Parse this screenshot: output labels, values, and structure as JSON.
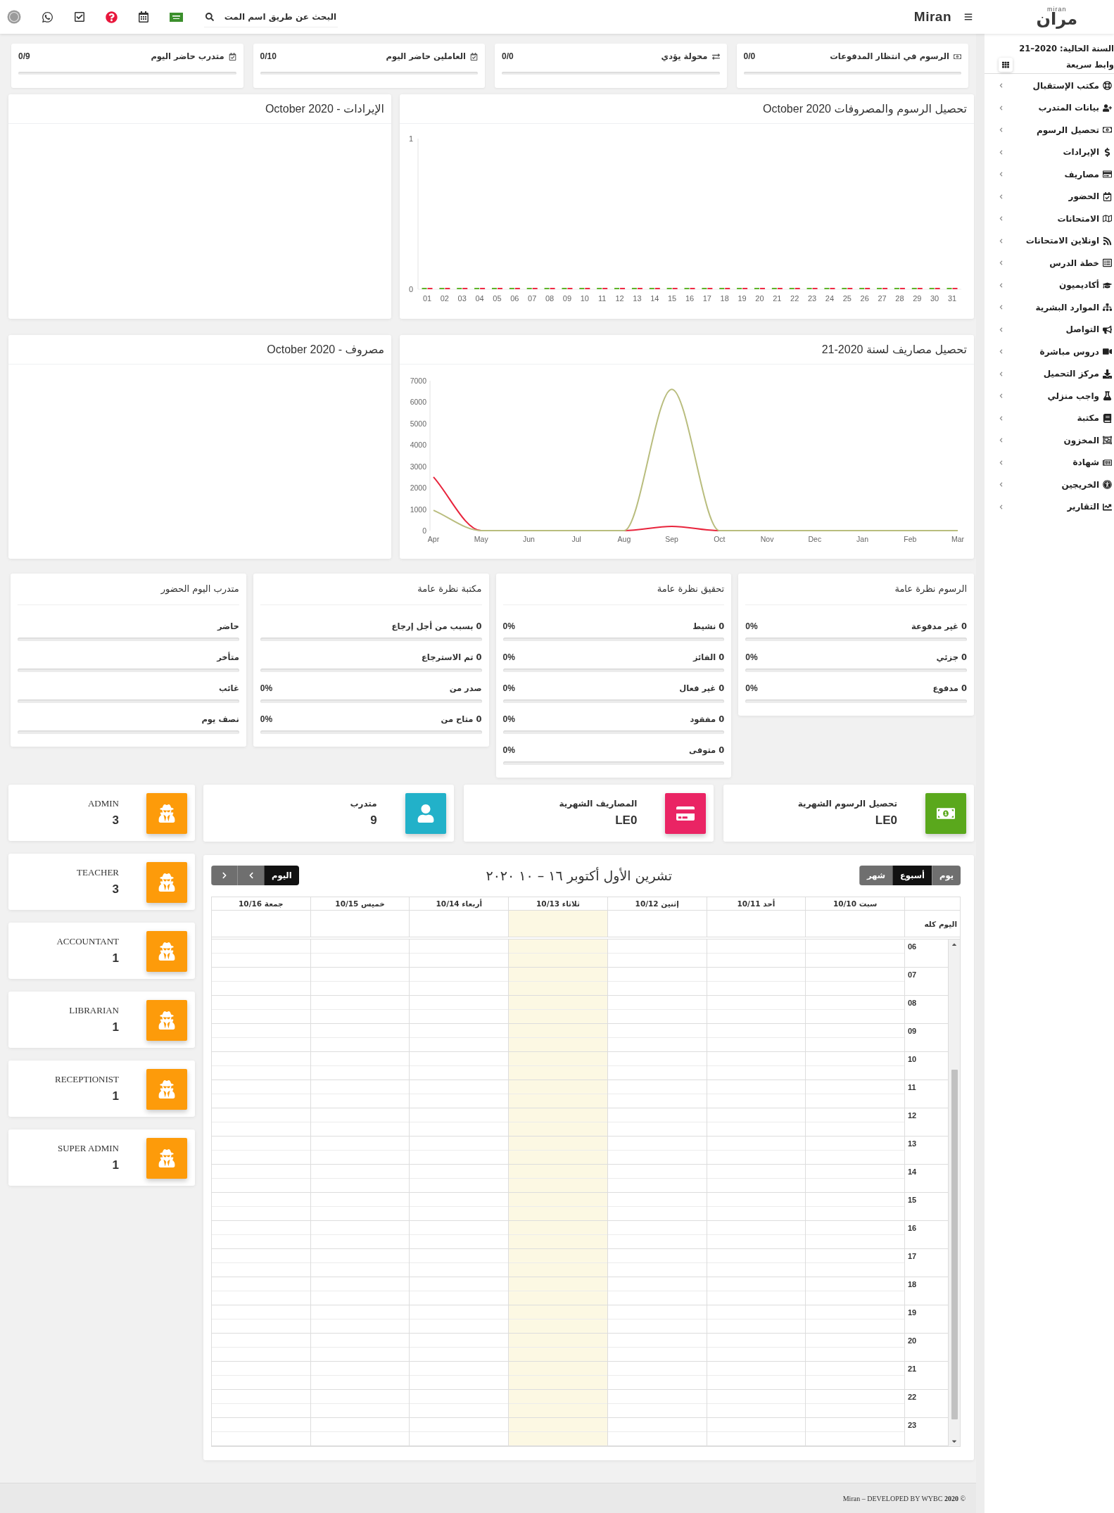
{
  "topbar": {
    "logo": {
      "text": "مران",
      "tagline": "miran"
    },
    "brand": "Miran",
    "search": {
      "placeholder": "البحث عن طريق اسم المت"
    }
  },
  "sidebar": {
    "year": "السنة الحالية: 2020–21",
    "quick_links": "وابط سريعة",
    "items": [
      {
        "label": "مكتب الإستقبال"
      },
      {
        "label": "بيانات المتدرب"
      },
      {
        "label": "تحصيل الرسوم"
      },
      {
        "label": "الإيرادات"
      },
      {
        "label": "مصاريف"
      },
      {
        "label": "الحضور"
      },
      {
        "label": "الامتحانات"
      },
      {
        "label": "اونلاين الامتحانات"
      },
      {
        "label": "خطة الدرس"
      },
      {
        "label": "أكاديميون"
      },
      {
        "label": "الموارد البشرية"
      },
      {
        "label": "التواصل"
      },
      {
        "label": "دروس مباشرة"
      },
      {
        "label": "مركز التحميل"
      },
      {
        "label": "واجب منزلي"
      },
      {
        "label": "مكتبة"
      },
      {
        "label": "المخزون"
      },
      {
        "label": "شهادة"
      },
      {
        "label": "الخريجين"
      },
      {
        "label": "التقارير"
      }
    ]
  },
  "stat_cards": [
    {
      "title": "الرسوم في انتظار المدفوعات",
      "value": "0/0",
      "level": 0
    },
    {
      "title": "محولة يؤدي",
      "value": "0/0",
      "level": 0
    },
    {
      "title": "العاملين حاضر اليوم",
      "value": "0/10",
      "level": 0
    },
    {
      "title": "متدرب حاضر اليوم",
      "value": "0/9",
      "level": 0
    }
  ],
  "charts": [
    {
      "title": "تحصيل الرسوم والمصروفات October 2020",
      "chart_data": {
        "type": "bar",
        "categories": [
          "01",
          "02",
          "03",
          "04",
          "05",
          "06",
          "07",
          "08",
          "09",
          "10",
          "11",
          "12",
          "13",
          "14",
          "15",
          "16",
          "17",
          "18",
          "19",
          "20",
          "21",
          "22",
          "23",
          "24",
          "25",
          "26",
          "27",
          "28",
          "29",
          "30",
          "31"
        ],
        "series": [
          {
            "color": "#5fb52a",
            "values": [
              0,
              0,
              0,
              0,
              0,
              0,
              0,
              0,
              0,
              0,
              0,
              0,
              0,
              0,
              0,
              0,
              0,
              0,
              0,
              0,
              0,
              0,
              0,
              0,
              0,
              0,
              0,
              0,
              0,
              0,
              0
            ]
          },
          {
            "color": "#ef2b44",
            "values": [
              0,
              0,
              0,
              0,
              0,
              0,
              0,
              0,
              0,
              0,
              0,
              0,
              0,
              0,
              0,
              0,
              0,
              0,
              0,
              0,
              0,
              0,
              0,
              0,
              0,
              0,
              0,
              0,
              0,
              0,
              0
            ]
          }
        ],
        "ylim": [
          0,
          1
        ],
        "yticks": [
          0,
          1
        ]
      }
    },
    {
      "title": "الإيرادات - October 2020"
    },
    {
      "title": "تحصيل مصاريف لسنة 2020-21",
      "chart_data": {
        "type": "line",
        "categories": [
          "Apr",
          "May",
          "Jun",
          "Jul",
          "Aug",
          "Sep",
          "Oct",
          "Nov",
          "Dec",
          "Jan",
          "Feb",
          "Mar"
        ],
        "series": [
          {
            "color": "#b9bd7e",
            "values": [
              950,
              0,
              0,
              0,
              0,
              6600,
              0,
              0,
              0,
              0,
              0,
              0
            ]
          },
          {
            "color": "#e8243c",
            "values": [
              2500,
              0,
              null,
              null,
              0,
              200,
              0,
              null,
              null,
              null,
              null,
              null
            ]
          }
        ],
        "ylim": [
          0,
          7000
        ],
        "yticks": [
          0,
          1000,
          2000,
          3000,
          4000,
          5000,
          6000,
          7000
        ]
      }
    },
    {
      "title": "مصروف - October 2020"
    }
  ],
  "overviews": [
    {
      "title": "الرسوم نظرة عامة",
      "rows": [
        {
          "label": "0 غير مدفوعة",
          "percent": "0%",
          "level": 0
        },
        {
          "label": "0 جزئي",
          "percent": "0%",
          "level": 0
        },
        {
          "label": "0 مدفوع",
          "percent": "0%",
          "level": 0
        }
      ]
    },
    {
      "title": "تحقيق نظرة عامة",
      "rows": [
        {
          "label": "0 نشيط",
          "percent": "0%",
          "level": 0
        },
        {
          "label": "0 الفائز",
          "percent": "0%",
          "level": 0
        },
        {
          "label": "0 غير فعال",
          "percent": "0%",
          "level": 0
        },
        {
          "label": "0 مفقود",
          "percent": "0%",
          "level": 0
        },
        {
          "label": "0 متوفى",
          "percent": "0%",
          "level": 0
        }
      ]
    },
    {
      "title": "مكتبة نظرة عامة",
      "rows": [
        {
          "label": "0 بسبب من أجل إرجاع",
          "level": 0
        },
        {
          "label": "0 تم الاسترجاع",
          "level": 0
        },
        {
          "label": "صدر من",
          "percent": "0%",
          "level": 0
        },
        {
          "label": "0 متاح من",
          "percent": "0%",
          "level": 0
        }
      ]
    },
    {
      "title": "متدرب اليوم الحضور",
      "rows": [
        {
          "label": "حاضر",
          "level": 0
        },
        {
          "label": "متأخر",
          "level": 0
        },
        {
          "label": "غائب",
          "level": 0
        },
        {
          "label": "نصف يوم",
          "level": 0
        }
      ]
    }
  ],
  "summary_cards": [
    {
      "label": "تحصيل الرسوم الشهرية",
      "value": "LE0",
      "kind": "money"
    },
    {
      "label": "المصاريف الشهرية",
      "value": "LE0",
      "kind": "card"
    },
    {
      "label": "متدرب",
      "value": "9",
      "kind": "user"
    }
  ],
  "role_cards": [
    {
      "label": "ADMIN",
      "value": "3"
    },
    {
      "label": "TEACHER",
      "value": "3"
    },
    {
      "label": "ACCOUNTANT",
      "value": "1"
    },
    {
      "label": "LIBRARIAN",
      "value": "1"
    },
    {
      "label": "RECEPTIONIST",
      "value": "1"
    },
    {
      "label": "SUPER ADMIN",
      "value": "1"
    }
  ],
  "calendar": {
    "title": "تشرين الأول أكتوبر ١٦ – ١٠ ٢٠٢٠",
    "views": [
      {
        "label": "يوم",
        "selected": false
      },
      {
        "label": "أسبوع",
        "selected": true
      },
      {
        "label": "شهر",
        "selected": false
      }
    ],
    "today_button": {
      "label": "اليوم",
      "active": true
    },
    "days": [
      {
        "label": "سبت 10/10",
        "today": false
      },
      {
        "label": "أحد 10/11",
        "today": false
      },
      {
        "label": "إثنين 10/12",
        "today": false
      },
      {
        "label": "ثلاثاء 10/13",
        "today": true
      },
      {
        "label": "أربعاء 10/14",
        "today": false
      },
      {
        "label": "خميس 10/15",
        "today": false
      },
      {
        "label": "جمعة 10/16",
        "today": false
      }
    ],
    "all_day_label": "اليوم كله",
    "hours": [
      "06",
      "07",
      "08",
      "09",
      "10",
      "11",
      "12",
      "13",
      "14",
      "15",
      "16",
      "17",
      "18",
      "19",
      "20",
      "21",
      "22",
      "23"
    ]
  },
  "footer": "Miran – DEVELOPED BY WYBC **2020** ©"
}
